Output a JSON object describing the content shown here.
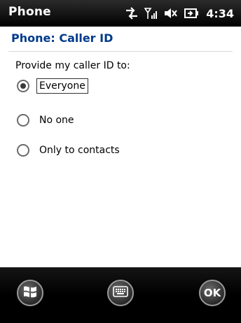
{
  "status_bar": {
    "app_name": "Phone",
    "time": "4:34"
  },
  "header": {
    "title": "Phone: Caller ID"
  },
  "caller_id": {
    "prompt": "Provide my caller ID to:",
    "options": [
      {
        "label": "Everyone",
        "selected": true
      },
      {
        "label": "No one",
        "selected": false
      },
      {
        "label": "Only to contacts",
        "selected": false
      }
    ]
  },
  "softkeys": {
    "ok_label": "OK"
  },
  "colors": {
    "title_blue": "#003a8c",
    "status_bg": "#000000"
  },
  "icons": [
    "data-transfer-icon",
    "signal-strength-icon",
    "speaker-muted-icon",
    "battery-charging-icon",
    "windows-start-icon",
    "keyboard-icon"
  ]
}
